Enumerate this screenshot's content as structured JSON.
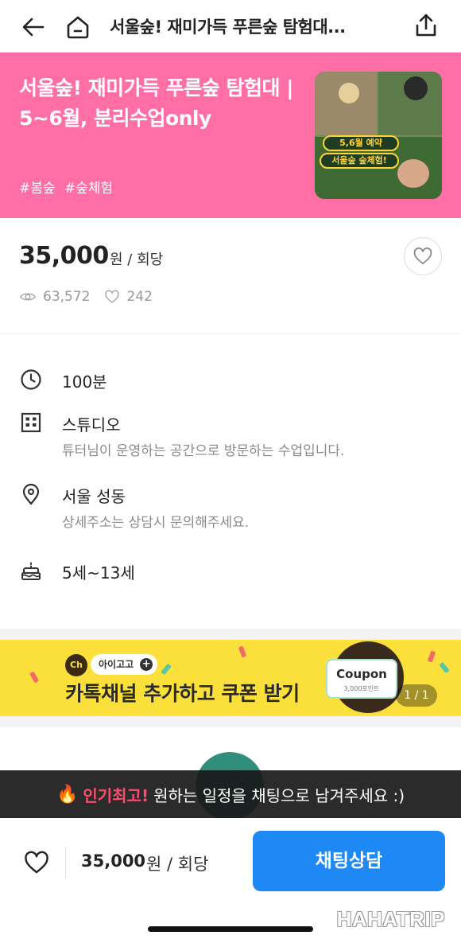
{
  "nav": {
    "title": "서울숲! 재미가득 푸른숲 탐험대..."
  },
  "hero": {
    "bg_color": "#ff6fa6",
    "title": "서울숲! 재미가득 푸른숲 탐험대 | 5~6월, 분리수업only",
    "tags": [
      "#봄숲",
      "#숲체험"
    ],
    "image_badges": [
      "5,6월 예약",
      "서울숲 숲체험!"
    ]
  },
  "price_block": {
    "price": "35,000",
    "unit": "원 / 회당",
    "views": "63,572",
    "likes": "242"
  },
  "info": [
    {
      "icon": "clock-icon",
      "main": "100분",
      "sub": ""
    },
    {
      "icon": "building-icon",
      "main": "스튜디오",
      "sub": "튜터님이 운영하는 공간으로 방문하는 수업입니다."
    },
    {
      "icon": "location-pin-icon",
      "main": "서울 성동",
      "sub": "상세주소는 상담시 문의해주세요."
    },
    {
      "icon": "cake-icon",
      "main": "5세~13세",
      "sub": ""
    }
  ],
  "coupon_banner": {
    "bg_color": "#fbe03c",
    "ch_logo": "Ch",
    "channel_name": "아이고고",
    "plus": "+",
    "headline": "카톡채널 추가하고 쿠폰 받기",
    "card_title": "Coupon",
    "card_sub": "3,000포인트",
    "pager": "1 / 1"
  },
  "toast": {
    "icon": "fire-icon",
    "highlight": "인기최고!",
    "message": "원하는 일정을 채팅으로 남겨주세요 :)"
  },
  "bottom_bar": {
    "price": "35,000",
    "unit": "원 / 회당",
    "chat_label": "채팅상담",
    "accent_color": "#1e88f5"
  },
  "watermark": "HAHATRIP"
}
